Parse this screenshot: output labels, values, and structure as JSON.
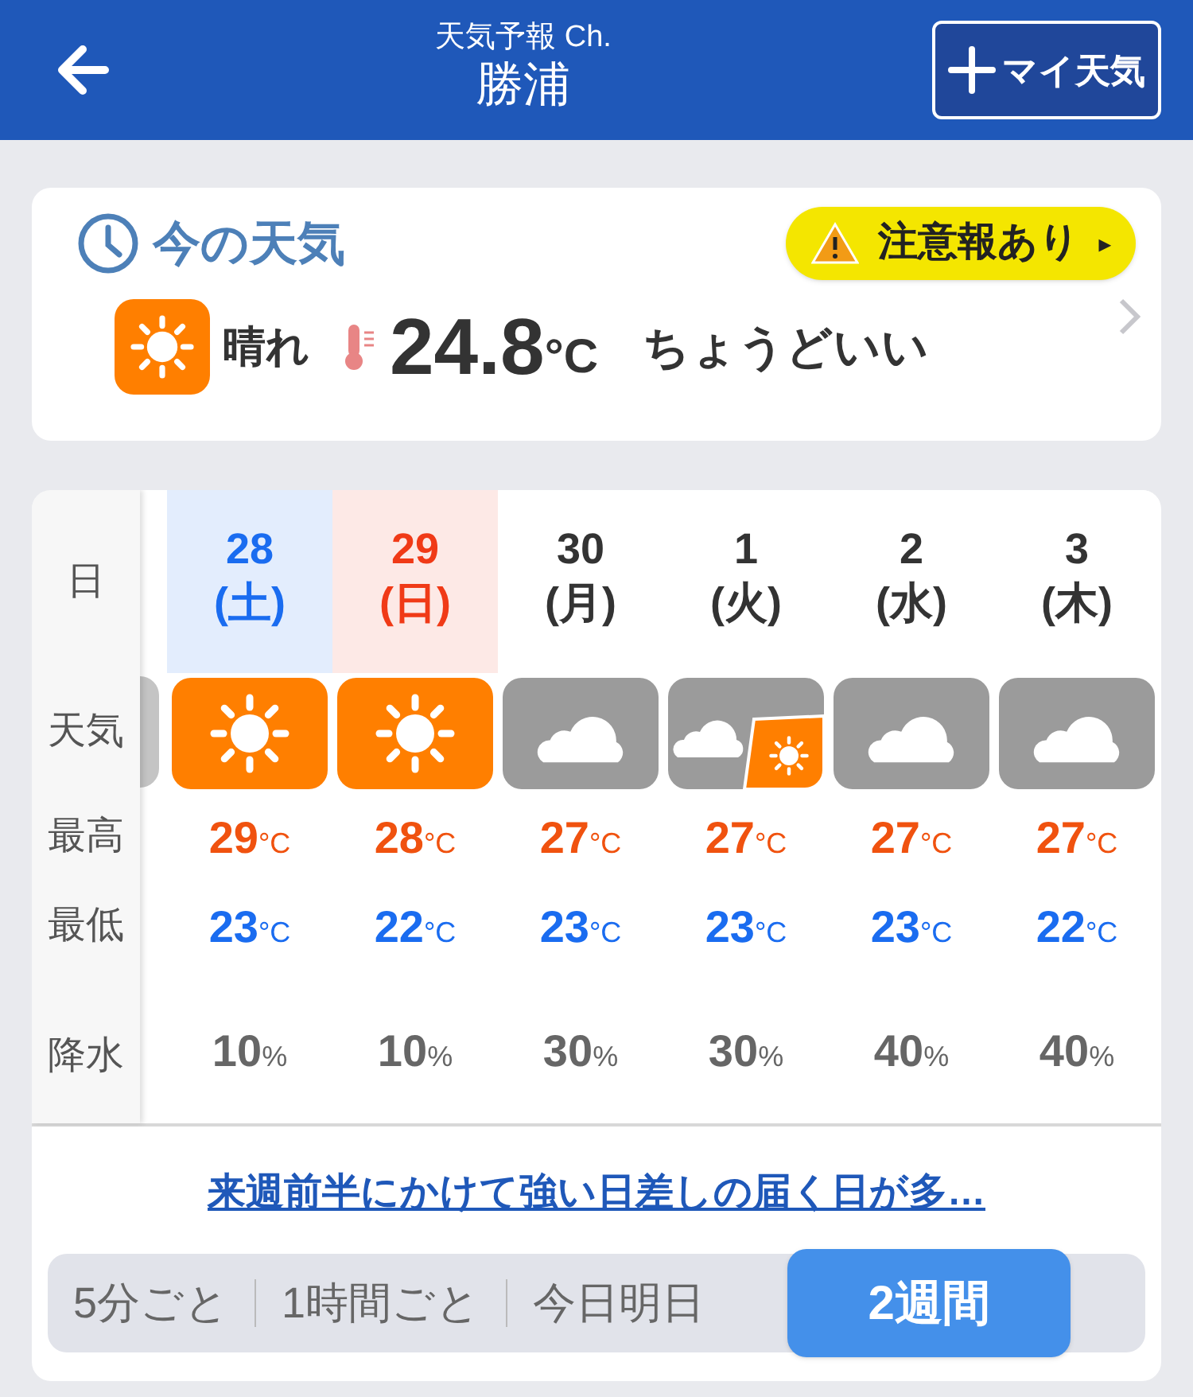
{
  "header": {
    "subtitle": "天気予報 Ch.",
    "title": "勝浦",
    "my_weather_button": "マイ天気"
  },
  "now": {
    "title": "今の天気",
    "alert": "注意報あり",
    "alert_arrow": "▸",
    "icon": {
      "kind": "sunny"
    },
    "weather": "晴れ",
    "temp": "24.8",
    "unit": "°C",
    "feeling": "ちょうどいい"
  },
  "forecast": {
    "row_labels": [
      "日",
      "天気",
      "最高",
      "最低",
      "降水"
    ],
    "days": [
      {
        "date": "28",
        "weekday": "(土)",
        "kind": "sat",
        "icon": {
          "kind": "sunny"
        },
        "high": "29",
        "high_unit": "°C",
        "low": "23",
        "low_unit": "°C",
        "precip": "10",
        "precip_unit": "%"
      },
      {
        "date": "29",
        "weekday": "(日)",
        "kind": "sun",
        "icon": {
          "kind": "sunny"
        },
        "high": "28",
        "high_unit": "°C",
        "low": "22",
        "low_unit": "°C",
        "precip": "10",
        "precip_unit": "%"
      },
      {
        "date": "30",
        "weekday": "(月)",
        "kind": "weekday",
        "icon": {
          "kind": "cloudy"
        },
        "high": "27",
        "high_unit": "°C",
        "low": "23",
        "low_unit": "°C",
        "precip": "30",
        "precip_unit": "%"
      },
      {
        "date": "1",
        "weekday": "(火)",
        "kind": "weekday",
        "icon": {
          "kind": "cloudy_sunny"
        },
        "high": "27",
        "high_unit": "°C",
        "low": "23",
        "low_unit": "°C",
        "precip": "30",
        "precip_unit": "%"
      },
      {
        "date": "2",
        "weekday": "(水)",
        "kind": "weekday",
        "icon": {
          "kind": "cloudy"
        },
        "high": "27",
        "high_unit": "°C",
        "low": "23",
        "low_unit": "°C",
        "precip": "40",
        "precip_unit": "%"
      },
      {
        "date": "3",
        "weekday": "(木)",
        "kind": "weekday",
        "icon": {
          "kind": "cloudy"
        },
        "high": "27",
        "high_unit": "°C",
        "low": "22",
        "low_unit": "°C",
        "precip": "40",
        "precip_unit": "%"
      }
    ]
  },
  "summary_link": "来週前半にかけて強い日差しの届く日が多…",
  "tabs": [
    {
      "label": "5分ごと",
      "selected": false
    },
    {
      "label": "1時間ごと",
      "selected": false
    },
    {
      "label": "今日明日",
      "selected": false
    },
    {
      "label": "2週間",
      "selected": true
    }
  ]
}
